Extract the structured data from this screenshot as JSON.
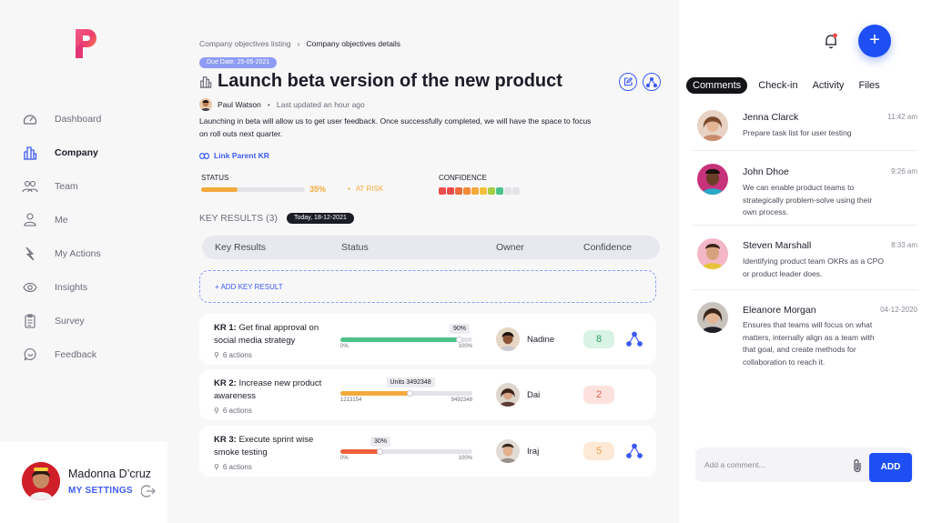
{
  "sidebar": {
    "logo_icon": "p-logo-icon",
    "items": [
      {
        "label": "Dashboard",
        "icon": "gauge-icon"
      },
      {
        "label": "Company",
        "icon": "building-icon",
        "active": true
      },
      {
        "label": "Team",
        "icon": "team-icon"
      },
      {
        "label": "Me",
        "icon": "person-icon"
      },
      {
        "label": "My Actions",
        "icon": "bolt-icon"
      },
      {
        "label": "Insights",
        "icon": "eye-icon"
      },
      {
        "label": "Survey",
        "icon": "clipboard-icon"
      },
      {
        "label": "Feedback",
        "icon": "chat-icon"
      }
    ],
    "user": {
      "name": "Madonna D’cruz",
      "settings_label": "MY SETTINGS"
    }
  },
  "main": {
    "breadcrumb": {
      "parent": "Company objectives listing",
      "separator": "›",
      "current": "Company objectives details"
    },
    "due_date": "Due Date:  25-05-2021",
    "title": "Launch beta version of the new product",
    "owner": "Paul Watson",
    "updated": "Last updated an hour ago",
    "description": "Launching in beta will allow us to get user feedback. Once successfully completed, we will have the space to focus on roll outs next quarter.",
    "link_parent": "Link Parent KR",
    "status": {
      "label": "STATUS",
      "percent_text": "35%",
      "percent": 35,
      "state": "AT RISK"
    },
    "confidence": {
      "label": "CONFIDENCE",
      "dot_colors": [
        "#ec4c4c",
        "#ec4c4c",
        "#f06a3c",
        "#f38a35",
        "#f4a93b",
        "#f6c13a",
        "#a6cd46",
        "#4cc38a",
        "#e3e3e8",
        "#e3e3e8"
      ]
    },
    "key_results": {
      "heading": "KEY RESULTS (3)",
      "today": "Today, 18-12-2021",
      "columns": [
        "Key Results",
        "Status",
        "Owner",
        "Confidence"
      ],
      "add_label": "+ ADD KEY RESULT",
      "rows": [
        {
          "code": "KR 1:",
          "text": "Get final approval on social media strategy",
          "actions": "6 actions",
          "tip": "90%",
          "progress": 0.9,
          "min": "0%",
          "max": "100%",
          "color": "#4cc38a",
          "owner": "Nadine",
          "confidence": "8",
          "conf_bg": "#d9f3e6",
          "conf_fg": "#2e9c63"
        },
        {
          "code": "KR 2:",
          "text": "Increase new product awareness",
          "actions": "6 actions",
          "tip": "Units 3492348",
          "progress": 0.53,
          "min": "1213154",
          "max": "9492348",
          "color": "#f4a93b",
          "owner": "Dai",
          "confidence": "2",
          "conf_bg": "#fde1dc",
          "conf_fg": "#e0654f"
        },
        {
          "code": "KR 3:",
          "text": "Execute sprint wise smoke testing",
          "actions": "6 actions",
          "tip": "30%",
          "progress": 0.3,
          "min": "0%",
          "max": "100%",
          "color": "#f0603c",
          "owner": "Iraj",
          "confidence": "5",
          "conf_bg": "#fde9d6",
          "conf_fg": "#f1a04b"
        }
      ]
    }
  },
  "right": {
    "tabs": [
      "Comments",
      "Check-in",
      "Activity",
      "Files"
    ],
    "fab_label": "+",
    "comments": [
      {
        "name": "Jenna Clarck",
        "time": "11:42 am",
        "text": "Prepare task list for user testing"
      },
      {
        "name": "John Dhoe",
        "time": "9:26 am",
        "text": "We can enable product teams to strategically problem-solve using their own process."
      },
      {
        "name": "Steven Marshall",
        "time": "8:33 am",
        "text": "Identifying product team OKRs as a CPO or product leader does."
      },
      {
        "name": "Eleanore Morgan",
        "time": "04-12-2020",
        "text": "Ensures that teams will focus on what matters, internally align as a team with that goal, and create methods for collaboration to reach it."
      }
    ],
    "comment_placeholder": "Add a comment...",
    "add_label": "ADD"
  },
  "colors": {
    "accent": "#1d4ff5",
    "link": "#3d5bf5",
    "warning": "#f4a93b"
  }
}
